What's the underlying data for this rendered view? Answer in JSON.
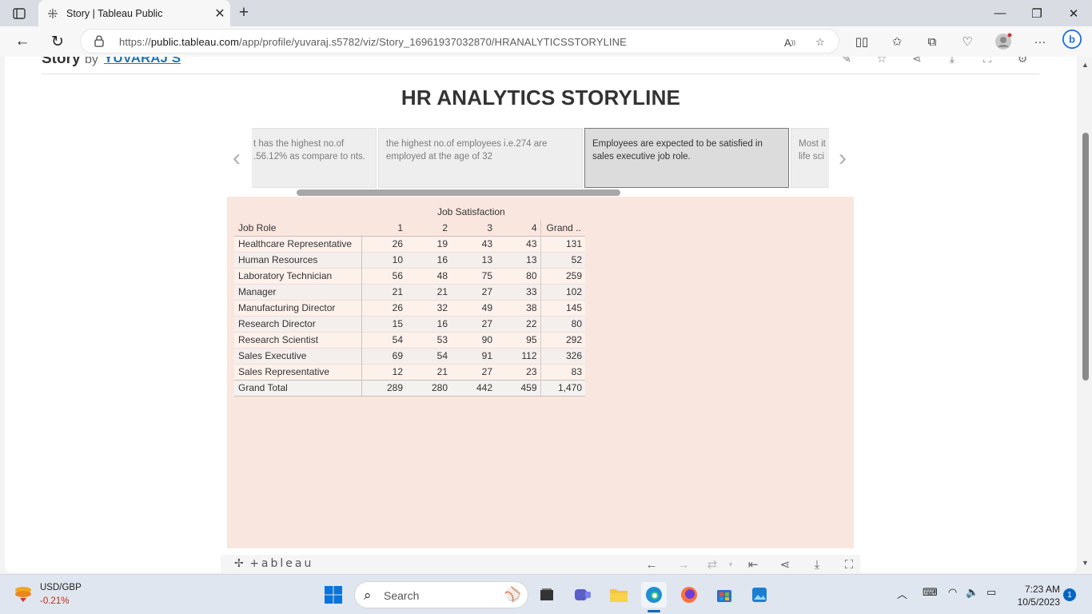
{
  "browser": {
    "tab_title": "Story | Tableau Public",
    "url_prefix": "https://",
    "url_host": "public.tableau.com",
    "url_path": "/app/profile/yuvaraj.s5782/viz/Story_16961937032870/HRANALYTICSSTORYLINE"
  },
  "story_header": {
    "title": "Story",
    "by": "by",
    "author": "YUVARAJ S"
  },
  "story": {
    "title": "HR ANALYTICS STORYLINE",
    "points": [
      {
        "text": "t has the highest no.of .56.12% as compare to nts."
      },
      {
        "text": "the highest no.of employees i.e.274 are employed at the age of 32"
      },
      {
        "text": "Employees are expected to be satisfied in sales executive job role."
      },
      {
        "text": "Most it life sci"
      }
    ]
  },
  "crosstab": {
    "column_field": "Job Satisfaction",
    "row_header": "Job Role",
    "columns": [
      "1",
      "2",
      "3",
      "4"
    ],
    "grand_header": "Grand ..",
    "rows": [
      {
        "label": "Healthcare Representative",
        "values": [
          "26",
          "19",
          "43",
          "43"
        ],
        "total": "131"
      },
      {
        "label": "Human Resources",
        "values": [
          "10",
          "16",
          "13",
          "13"
        ],
        "total": "52"
      },
      {
        "label": "Laboratory Technician",
        "values": [
          "56",
          "48",
          "75",
          "80"
        ],
        "total": "259"
      },
      {
        "label": "Manager",
        "values": [
          "21",
          "21",
          "27",
          "33"
        ],
        "total": "102"
      },
      {
        "label": "Manufacturing Director",
        "values": [
          "26",
          "32",
          "49",
          "38"
        ],
        "total": "145"
      },
      {
        "label": "Research Director",
        "values": [
          "15",
          "16",
          "27",
          "22"
        ],
        "total": "80"
      },
      {
        "label": "Research Scientist",
        "values": [
          "54",
          "53",
          "90",
          "95"
        ],
        "total": "292"
      },
      {
        "label": "Sales Executive",
        "values": [
          "69",
          "54",
          "91",
          "112"
        ],
        "total": "326"
      },
      {
        "label": "Sales Representative",
        "values": [
          "12",
          "21",
          "27",
          "23"
        ],
        "total": "83"
      }
    ],
    "grand_total": {
      "label": "Grand Total",
      "values": [
        "289",
        "280",
        "442",
        "459"
      ],
      "total": "1,470"
    }
  },
  "viz_toolbar": {
    "logo": "+ableau"
  },
  "taskbar": {
    "stock_ticker": "USD/GBP",
    "stock_change": "-0.21%",
    "search_placeholder": "Search",
    "time": "7:23 AM",
    "date": "10/5/2023",
    "notification_count": "1"
  },
  "colors": {
    "viz_background": "#f9e7df",
    "author_link": "#1f77b4",
    "accent": "#0067c0"
  }
}
